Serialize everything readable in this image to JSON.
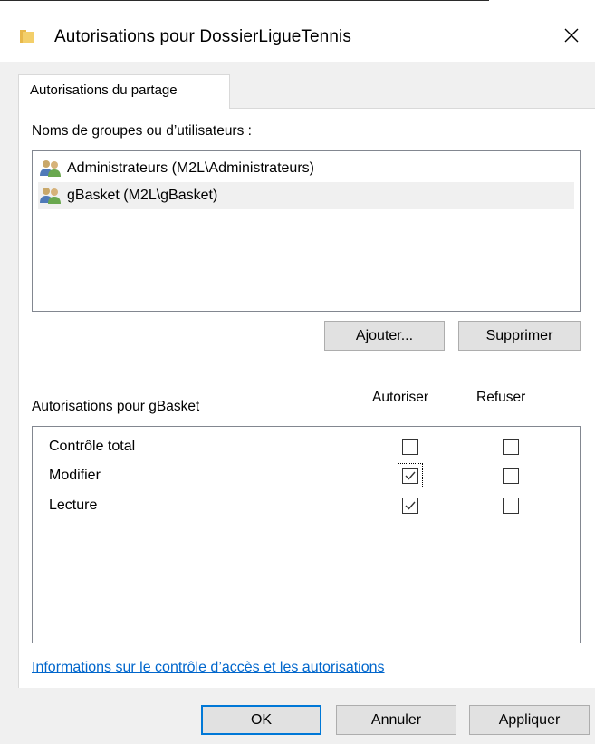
{
  "window": {
    "title": "Autorisations pour DossierLigueTennis",
    "close_symbol": "✕"
  },
  "tab": {
    "label": "Autorisations du partage"
  },
  "groups": {
    "label": "Noms de groupes ou d’utilisateurs :",
    "items": [
      {
        "name": "Administrateurs (M2L\\Administrateurs)",
        "icon": "users-group-icon",
        "selected": false
      },
      {
        "name": "gBasket (M2L\\gBasket)",
        "icon": "users-group-icon",
        "selected": true
      }
    ],
    "add_button": "Ajouter...",
    "remove_button": "Supprimer"
  },
  "permissions": {
    "label": "Autorisations pour gBasket",
    "allow_header": "Autoriser",
    "deny_header": "Refuser",
    "rows": [
      {
        "name": "Contrôle total",
        "allow": false,
        "deny": false
      },
      {
        "name": "Modifier",
        "allow": true,
        "deny": false,
        "focused": true
      },
      {
        "name": "Lecture",
        "allow": true,
        "deny": false
      }
    ]
  },
  "info_link": "Informations sur le contrôle d’accès et les autorisations",
  "footer": {
    "ok": "OK",
    "cancel": "Annuler",
    "apply": "Appliquer"
  },
  "colors": {
    "accent": "#0078d7",
    "link": "#0066cc",
    "folder": "#e8b84a"
  }
}
